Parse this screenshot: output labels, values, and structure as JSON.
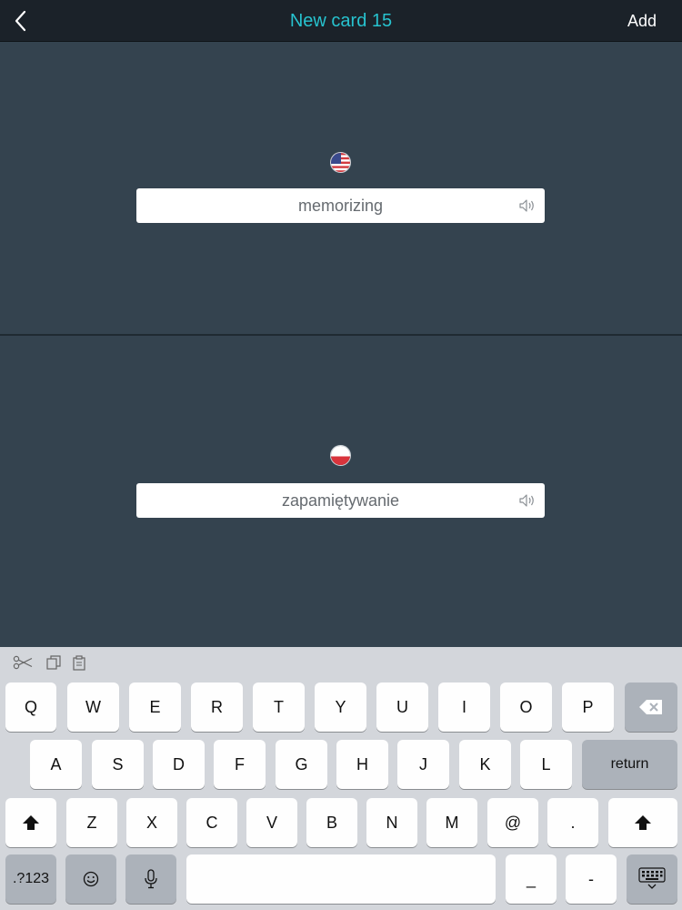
{
  "nav": {
    "title": "New card 15",
    "add_label": "Add"
  },
  "front": {
    "language": "us-flag-icon",
    "text": "memorizing"
  },
  "back": {
    "language": "pl-flag-icon",
    "text": "zapamiętywanie"
  },
  "keyboard": {
    "row1": [
      "Q",
      "W",
      "E",
      "R",
      "T",
      "Y",
      "U",
      "I",
      "O",
      "P"
    ],
    "row2": [
      "A",
      "S",
      "D",
      "F",
      "G",
      "H",
      "J",
      "K",
      "L"
    ],
    "row3": [
      "Z",
      "X",
      "C",
      "V",
      "B",
      "N",
      "M",
      "@",
      "."
    ],
    "return_label": "return",
    "numbers_label": ".?123",
    "underscore_label": "_",
    "dash_label": "-"
  },
  "colors": {
    "accent": "#27c3cf",
    "navbar": "#1b2229",
    "panel": "#34434f",
    "keyboard": "#d3d6db"
  }
}
